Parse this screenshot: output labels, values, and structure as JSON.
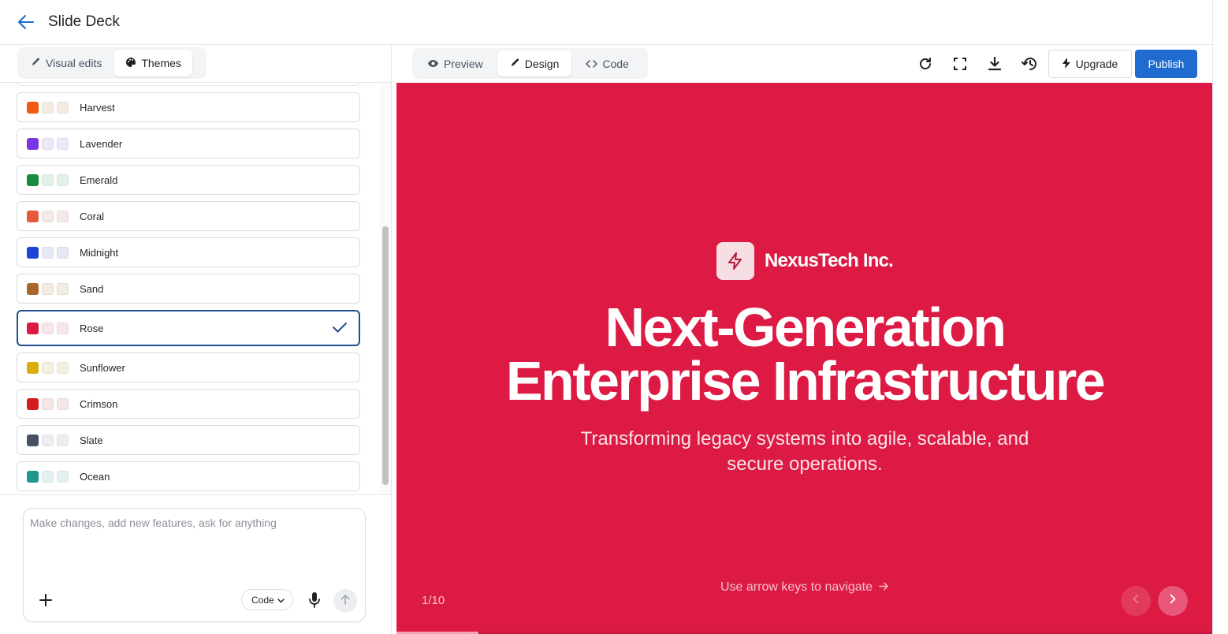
{
  "header": {
    "title": "Slide Deck"
  },
  "left_tabs": [
    {
      "label": "Visual edits",
      "icon": "pencil-icon",
      "active": false
    },
    {
      "label": "Themes",
      "icon": "palette-icon",
      "active": true
    }
  ],
  "themes": [
    {
      "name": "Harvest",
      "colors": [
        "#f05a14",
        "#f4ece3",
        "#f4ece3"
      ]
    },
    {
      "name": "Lavender",
      "colors": [
        "#7a35e6",
        "#ede8f7",
        "#ede8f7"
      ]
    },
    {
      "name": "Emerald",
      "colors": [
        "#1a8a3e",
        "#e3f2e7",
        "#e3f2e7"
      ]
    },
    {
      "name": "Coral",
      "colors": [
        "#e65a3a",
        "#f4e9e4",
        "#f4e9e4"
      ]
    },
    {
      "name": "Midnight",
      "colors": [
        "#1c44d6",
        "#e6e9f3",
        "#e6e9f3"
      ]
    },
    {
      "name": "Sand",
      "colors": [
        "#a8672a",
        "#f3ece2",
        "#f3ece2"
      ]
    },
    {
      "name": "Rose",
      "colors": [
        "#dc1a43",
        "#f5e6ea",
        "#f5e6ea"
      ],
      "selected": true
    },
    {
      "name": "Sunflower",
      "colors": [
        "#dbae0d",
        "#f4efe0",
        "#f4efe0"
      ]
    },
    {
      "name": "Crimson",
      "colors": [
        "#d41c1c",
        "#f4e6e6",
        "#f4e6e6"
      ]
    },
    {
      "name": "Slate",
      "colors": [
        "#475163",
        "#eceef1",
        "#eceef1"
      ]
    },
    {
      "name": "Ocean",
      "colors": [
        "#1f978e",
        "#e3f2f1",
        "#e3f2f1"
      ]
    }
  ],
  "chat": {
    "placeholder": "Make changes, add new features, ask for anything",
    "mode": "Code"
  },
  "view_tabs": [
    {
      "label": "Preview",
      "icon": "eye-icon",
      "active": false
    },
    {
      "label": "Design",
      "icon": "pencil-icon",
      "active": true
    },
    {
      "label": "Code",
      "icon": "code-icon",
      "active": false
    }
  ],
  "toolbar": {
    "icons": [
      "refresh-icon",
      "fullscreen-icon",
      "download-icon",
      "history-icon"
    ],
    "upgrade_label": "Upgrade",
    "publish_label": "Publish"
  },
  "slide": {
    "brand": "NexusTech Inc.",
    "headline_line1": "Next-Generation",
    "headline_line2": "Enterprise Infrastructure",
    "subtitle_line1": "Transforming legacy systems into agile, scalable, and",
    "subtitle_line2": "secure operations.",
    "nav_hint": "Use arrow keys to navigate",
    "counter": "1/10",
    "progress": 0.1,
    "background": "#dc1a43"
  },
  "colors": {
    "accent": "#1f6bd0",
    "selected_border": "#1e4f8f"
  }
}
